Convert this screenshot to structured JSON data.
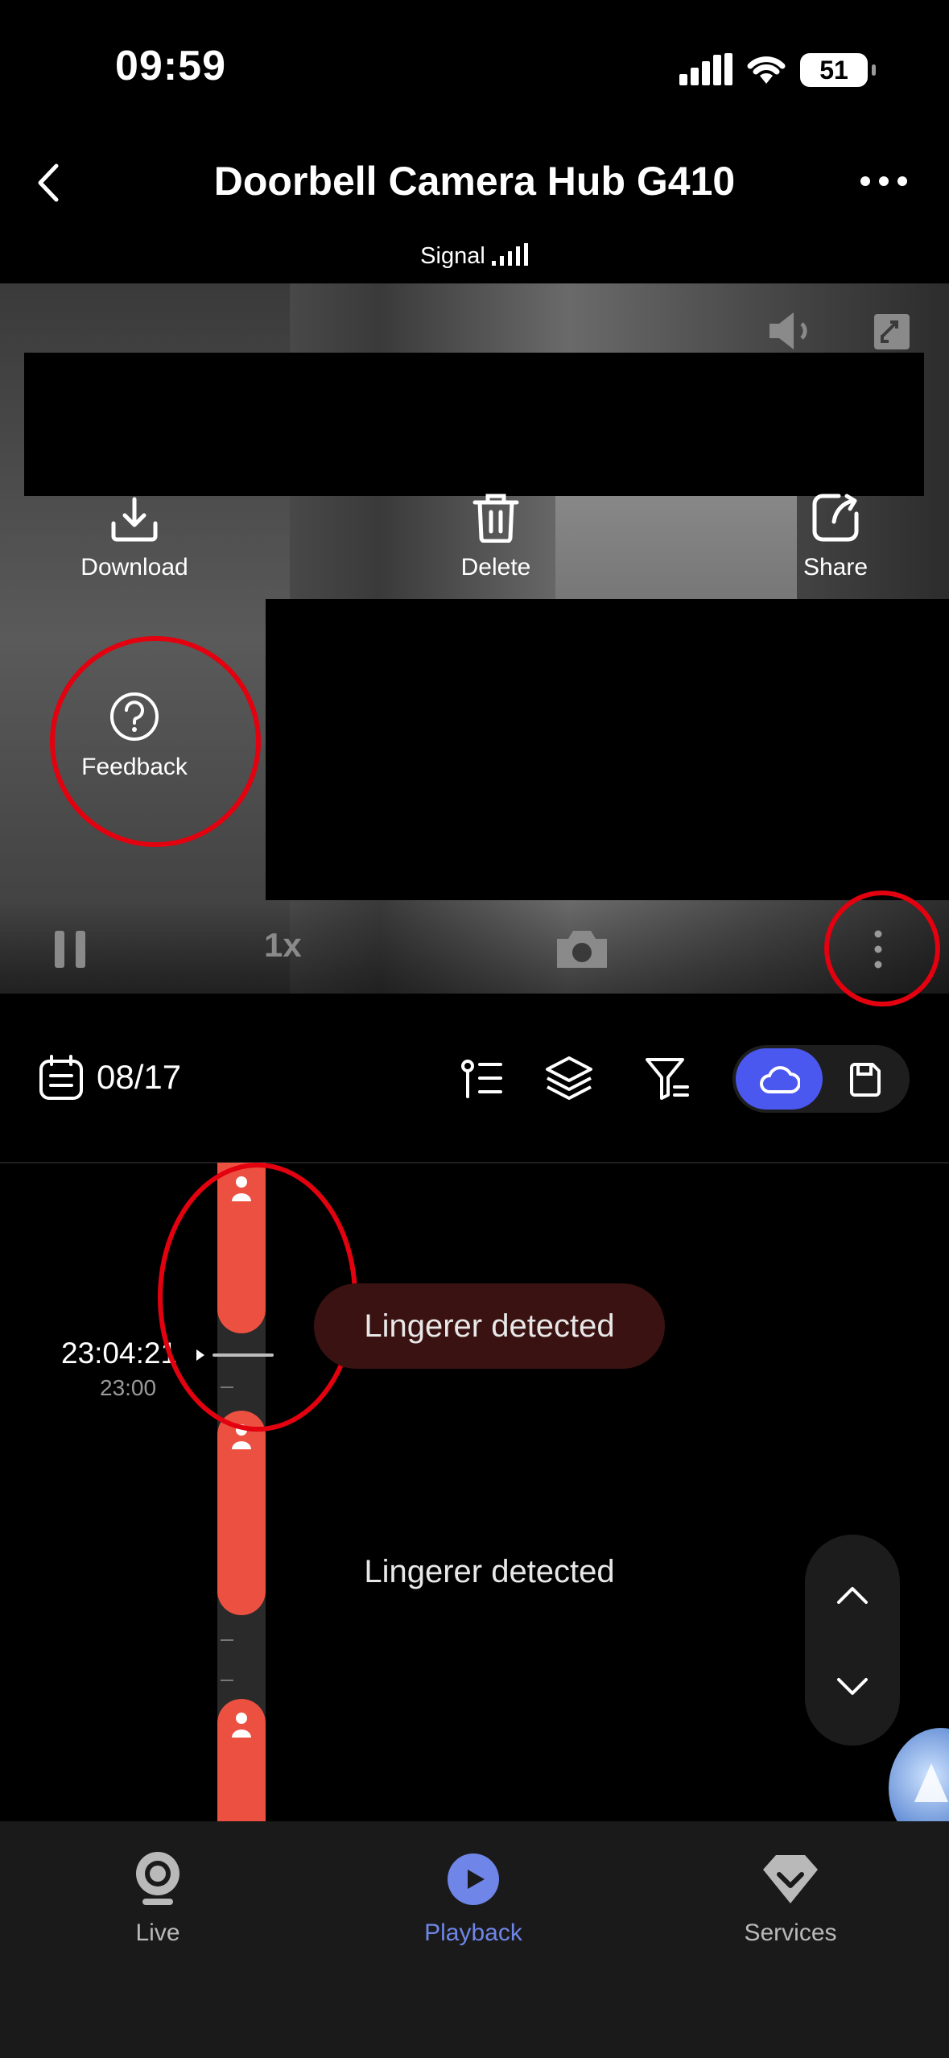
{
  "status_bar": {
    "time": "09:59",
    "battery": "51"
  },
  "header": {
    "title": "Doorbell Camera Hub G410",
    "signal_label": "Signal"
  },
  "video_actions": {
    "download": "Download",
    "delete": "Delete",
    "share": "Share",
    "feedback": "Feedback"
  },
  "playback_controls": {
    "speed": "1x"
  },
  "toolbar": {
    "date": "08/17"
  },
  "timeline": {
    "current_time": "23:04:21",
    "hour_label": "23:00",
    "events": [
      "Lingerer detected",
      "Lingerer detected"
    ]
  },
  "bottom_nav": {
    "items": [
      {
        "label": "Live",
        "icon": "camera-icon"
      },
      {
        "label": "Playback",
        "icon": "play-icon",
        "active": true
      },
      {
        "label": "Services",
        "icon": "diamond-icon"
      }
    ]
  },
  "colors": {
    "accent": "#4a58f0",
    "event": "#eb5040",
    "annotation": "#e3000f",
    "active_nav": "#6f86e8"
  }
}
